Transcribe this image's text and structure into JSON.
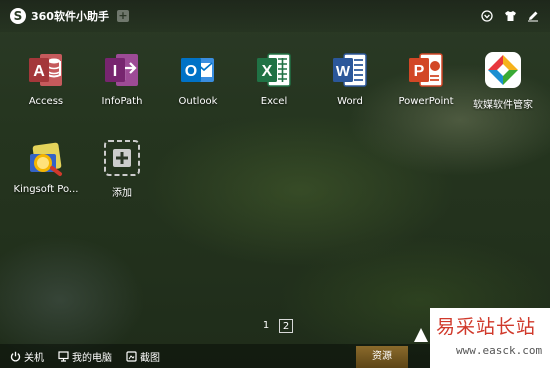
{
  "titlebar": {
    "app_title": "360软件小助手",
    "logo_icon": "360-logo-icon",
    "add_icon": "plus-icon",
    "tools": [
      "menu-icon",
      "skin-icon",
      "edit-icon"
    ]
  },
  "apps": [
    {
      "label": "Access",
      "icon": "access-icon",
      "color": "#a4373a"
    },
    {
      "label": "InfoPath",
      "icon": "infopath-icon",
      "color": "#77256f"
    },
    {
      "label": "Outlook",
      "icon": "outlook-icon",
      "color": "#0072c6"
    },
    {
      "label": "Excel",
      "icon": "excel-icon",
      "color": "#207245"
    },
    {
      "label": "Word",
      "icon": "word-icon",
      "color": "#2b579a"
    },
    {
      "label": "PowerPoint",
      "icon": "powerpoint-icon",
      "color": "#d24726"
    },
    {
      "label": "软媒软件管家",
      "icon": "ruanmei-icon",
      "color": "#1b8fd2"
    },
    {
      "label": "Kingsoft Po...",
      "icon": "kingsoft-icon",
      "color": "#f0b400"
    },
    {
      "label": "添加",
      "icon": "add-app-icon",
      "color": "#cccccc"
    }
  ],
  "pagination": {
    "pages": [
      "1",
      "2"
    ],
    "current": "2"
  },
  "bottombar": {
    "shutdown": "关机",
    "my_computer": "我的电脑",
    "screenshot": "截图",
    "resources": "资源"
  },
  "watermark": {
    "title": "易采站长站",
    "url": "www.easck.com"
  }
}
